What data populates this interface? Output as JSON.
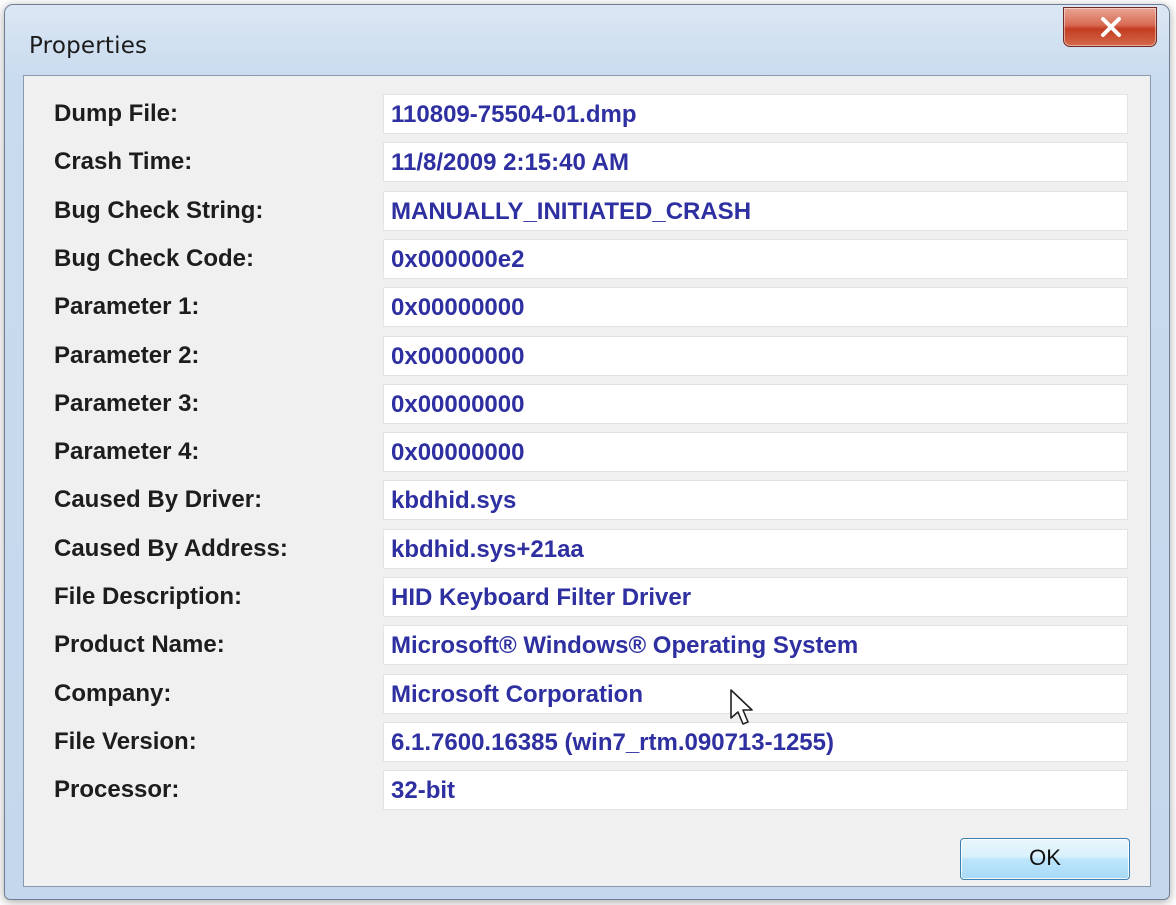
{
  "window": {
    "title": "Properties",
    "close_icon": "close-icon"
  },
  "properties": [
    {
      "label": "Dump File:",
      "value": "110809-75504-01.dmp"
    },
    {
      "label": "Crash Time:",
      "value": "11/8/2009 2:15:40 AM"
    },
    {
      "label": "Bug Check String:",
      "value": "MANUALLY_INITIATED_CRASH"
    },
    {
      "label": "Bug Check Code:",
      "value": "0x000000e2"
    },
    {
      "label": "Parameter 1:",
      "value": "0x00000000"
    },
    {
      "label": "Parameter 2:",
      "value": "0x00000000"
    },
    {
      "label": "Parameter 3:",
      "value": "0x00000000"
    },
    {
      "label": "Parameter 4:",
      "value": "0x00000000"
    },
    {
      "label": "Caused By Driver:",
      "value": "kbdhid.sys"
    },
    {
      "label": "Caused By Address:",
      "value": "kbdhid.sys+21aa"
    },
    {
      "label": "File Description:",
      "value": "HID Keyboard Filter Driver"
    },
    {
      "label": "Product Name:",
      "value": "Microsoft® Windows® Operating System"
    },
    {
      "label": "Company:",
      "value": "Microsoft Corporation"
    },
    {
      "label": "File Version:",
      "value": "6.1.7600.16385 (win7_rtm.090713-1255)"
    },
    {
      "label": "Processor:",
      "value": "32-bit"
    }
  ],
  "buttons": {
    "ok_label": "OK"
  },
  "colors": {
    "value_text": "#2e2fa0",
    "label_text": "#1d1d1d",
    "close_button": "#c43c22"
  }
}
